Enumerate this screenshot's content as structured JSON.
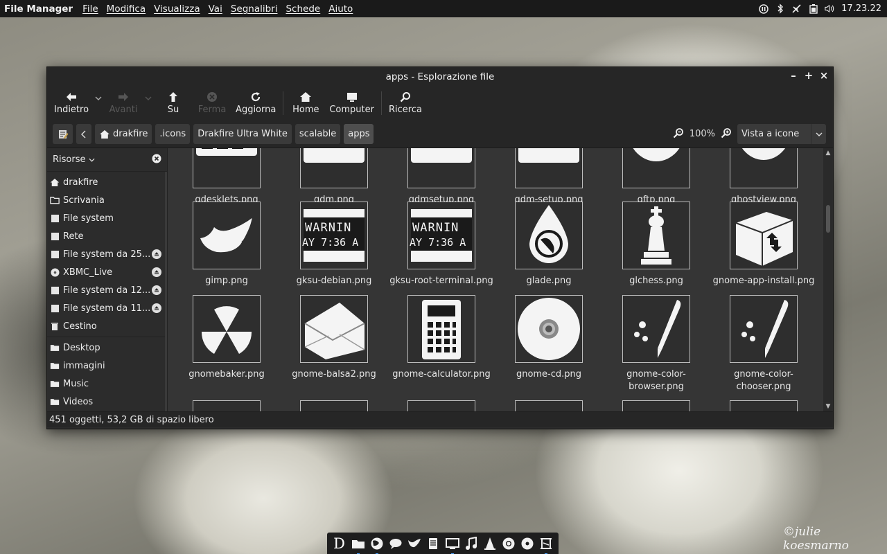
{
  "top_panel": {
    "app_name": "File Manager",
    "menus": [
      "File",
      "Modifica",
      "Visualizza",
      "Vai",
      "Segnalibri",
      "Schede",
      "Aiuto"
    ],
    "tray_icons": [
      "pause-icon",
      "bluetooth-icon",
      "network-disabled-icon",
      "battery-icon",
      "volume-icon"
    ],
    "clock": "17.23.22"
  },
  "window": {
    "title": "apps - Esplorazione file",
    "controls": [
      "minimize-icon",
      "maximize-icon",
      "close-icon"
    ]
  },
  "toolbar": {
    "back": "Indietro",
    "forward": "Avanti",
    "up": "Su",
    "stop": "Ferma",
    "reload": "Aggiorna",
    "home": "Home",
    "computer": "Computer",
    "search": "Ricerca"
  },
  "location": {
    "crumbs": [
      "drakfire",
      ".icons",
      "Drakfire Ultra White",
      "scalable",
      "apps"
    ],
    "active_crumb": "apps",
    "zoom": "100%",
    "view_mode": "Vista a icone"
  },
  "sidebar": {
    "header": "Risorse",
    "places": [
      {
        "label": "drakfire",
        "icon": "home-icon"
      },
      {
        "label": "Scrivania",
        "icon": "desktop-folder-icon"
      },
      {
        "label": "File system",
        "icon": "drive-icon"
      },
      {
        "label": "Rete",
        "icon": "network-icon"
      },
      {
        "label": "File system da 25...",
        "icon": "drive-icon",
        "eject": true
      },
      {
        "label": "XBMC_Live",
        "icon": "disc-icon",
        "eject": true
      },
      {
        "label": "File system da 12...",
        "icon": "drive-icon",
        "eject": true
      },
      {
        "label": "File system da 11...",
        "icon": "drive-icon",
        "eject": true
      },
      {
        "label": "Cestino",
        "icon": "trash-icon"
      }
    ],
    "bookmarks": [
      {
        "label": "Desktop",
        "icon": "folder-icon"
      },
      {
        "label": "immagini",
        "icon": "folder-icon"
      },
      {
        "label": "Music",
        "icon": "folder-icon"
      },
      {
        "label": "Videos",
        "icon": "folder-icon"
      }
    ]
  },
  "files": {
    "row0": [
      "gdesklets.png",
      "gdm.png",
      "gdmsetup.png",
      "gdm-setup.png",
      "gftp.png",
      "ghostview.png"
    ],
    "row1": [
      "gimp.png",
      "gksu-debian.png",
      "gksu-root-terminal.png",
      "glade.png",
      "glchess.png",
      "gnome-app-install.png"
    ],
    "row2": [
      "gnomebaker.png",
      "gnome-balsa2.png",
      "gnome-calculator.png",
      "gnome-cd.png",
      "gnome-color-browser.png",
      "gnome-color-chooser.png"
    ],
    "terminal_text_1": "WARNIN",
    "terminal_text_2": "AY 7:36 A"
  },
  "status": "451 oggetti, 53,2 GB di spazio libero",
  "dock": {
    "items": [
      "drakfire-launcher-icon",
      "files-icon",
      "firefox-icon",
      "chat-icon",
      "gimp-icon",
      "documents-icon",
      "monitor-icon",
      "music-icon",
      "vlc-icon",
      "chrome-icon",
      "disc-icon",
      "video-icon"
    ],
    "launcher_glyph": "D"
  },
  "watermark": "©julie koesmarno"
}
